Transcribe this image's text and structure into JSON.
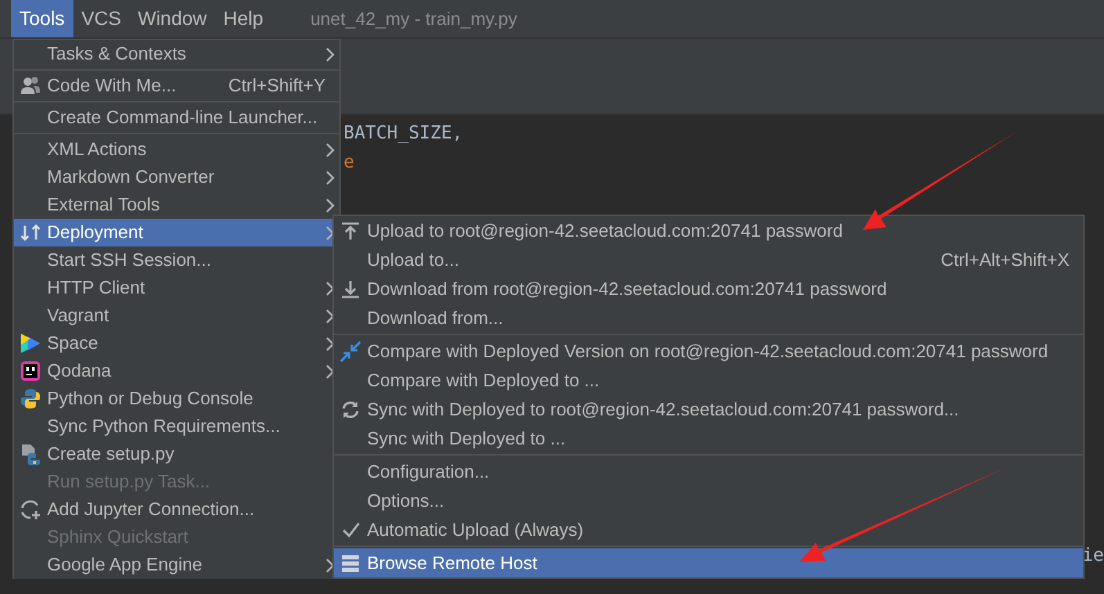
{
  "menu_bar": [
    {
      "label": "Tools",
      "selected": true
    },
    {
      "label": "VCS",
      "selected": false
    },
    {
      "label": "Window",
      "selected": false
    },
    {
      "label": "Help",
      "selected": false
    }
  ],
  "window": {
    "title": "unet_42_my - train_my.py"
  },
  "editor": {
    "lines": [
      {
        "text": "BATCH_SIZE,",
        "kind": "code"
      },
      {
        "text": "e",
        "kind": "string"
      }
    ],
    "right_fragment": "ie"
  },
  "tools_menu": [
    {
      "kind": "item",
      "label": "Tasks & Contexts",
      "submenu": true,
      "disabled": false,
      "selected": false
    },
    {
      "kind": "separator"
    },
    {
      "kind": "item",
      "label": "Code With Me...",
      "shortcut": "Ctrl+Shift+Y",
      "submenu": false,
      "disabled": false,
      "selected": false
    },
    {
      "kind": "separator"
    },
    {
      "kind": "item",
      "label": "Create Command-line Launcher...",
      "submenu": false,
      "disabled": false,
      "selected": false
    },
    {
      "kind": "separator"
    },
    {
      "kind": "item",
      "label": "XML Actions",
      "submenu": true,
      "disabled": false,
      "selected": false
    },
    {
      "kind": "item",
      "label": "Markdown Converter",
      "submenu": true,
      "disabled": false,
      "selected": false
    },
    {
      "kind": "item",
      "label": "External Tools",
      "submenu": true,
      "disabled": false,
      "selected": false
    },
    {
      "kind": "item",
      "label": "Deployment",
      "submenu": true,
      "disabled": false,
      "selected": true
    },
    {
      "kind": "item",
      "label": "Start SSH Session...",
      "submenu": false,
      "disabled": false,
      "selected": false
    },
    {
      "kind": "item",
      "label": "HTTP Client",
      "submenu": true,
      "disabled": false,
      "selected": false
    },
    {
      "kind": "item",
      "label": "Vagrant",
      "submenu": true,
      "disabled": false,
      "selected": false
    },
    {
      "kind": "item",
      "label": "Space",
      "submenu": true,
      "disabled": false,
      "selected": false
    },
    {
      "kind": "item",
      "label": "Qodana",
      "submenu": true,
      "disabled": false,
      "selected": false
    },
    {
      "kind": "item",
      "label": "Python or Debug Console",
      "submenu": false,
      "disabled": false,
      "selected": false
    },
    {
      "kind": "item",
      "label": "Sync Python Requirements...",
      "submenu": false,
      "disabled": false,
      "selected": false
    },
    {
      "kind": "item",
      "label": "Create setup.py",
      "submenu": false,
      "disabled": false,
      "selected": false
    },
    {
      "kind": "item",
      "label": "Run setup.py Task...",
      "submenu": false,
      "disabled": true,
      "selected": false
    },
    {
      "kind": "item",
      "label": "Add Jupyter Connection...",
      "submenu": false,
      "disabled": false,
      "selected": false
    },
    {
      "kind": "item",
      "label": "Sphinx Quickstart",
      "submenu": false,
      "disabled": true,
      "selected": false
    },
    {
      "kind": "item",
      "label": "Google App Engine",
      "submenu": true,
      "disabled": false,
      "selected": false
    }
  ],
  "deployment_menu": [
    {
      "kind": "item",
      "label": "Upload to root@region-42.seetacloud.com:20741 password",
      "checked": false,
      "selected": false
    },
    {
      "kind": "item",
      "label": "Upload to...",
      "shortcut": "Ctrl+Alt+Shift+X",
      "checked": false,
      "selected": false
    },
    {
      "kind": "item",
      "label": "Download from root@region-42.seetacloud.com:20741 password",
      "checked": false,
      "selected": false
    },
    {
      "kind": "item",
      "label": "Download from...",
      "checked": false,
      "selected": false
    },
    {
      "kind": "separator"
    },
    {
      "kind": "item",
      "label": "Compare with Deployed Version on root@region-42.seetacloud.com:20741 password",
      "checked": false,
      "selected": false
    },
    {
      "kind": "item",
      "label": "Compare with Deployed to ...",
      "checked": false,
      "selected": false
    },
    {
      "kind": "item",
      "label": "Sync with Deployed to root@region-42.seetacloud.com:20741 password...",
      "checked": false,
      "selected": false
    },
    {
      "kind": "item",
      "label": "Sync with Deployed to ...",
      "checked": false,
      "selected": false
    },
    {
      "kind": "separator"
    },
    {
      "kind": "item",
      "label": "Configuration...",
      "checked": false,
      "selected": false
    },
    {
      "kind": "item",
      "label": "Options...",
      "checked": false,
      "selected": false
    },
    {
      "kind": "item",
      "label": "Automatic Upload (Always)",
      "checked": true,
      "selected": false
    },
    {
      "kind": "separator"
    },
    {
      "kind": "item",
      "label": "Browse Remote Host",
      "checked": false,
      "selected": true
    }
  ]
}
